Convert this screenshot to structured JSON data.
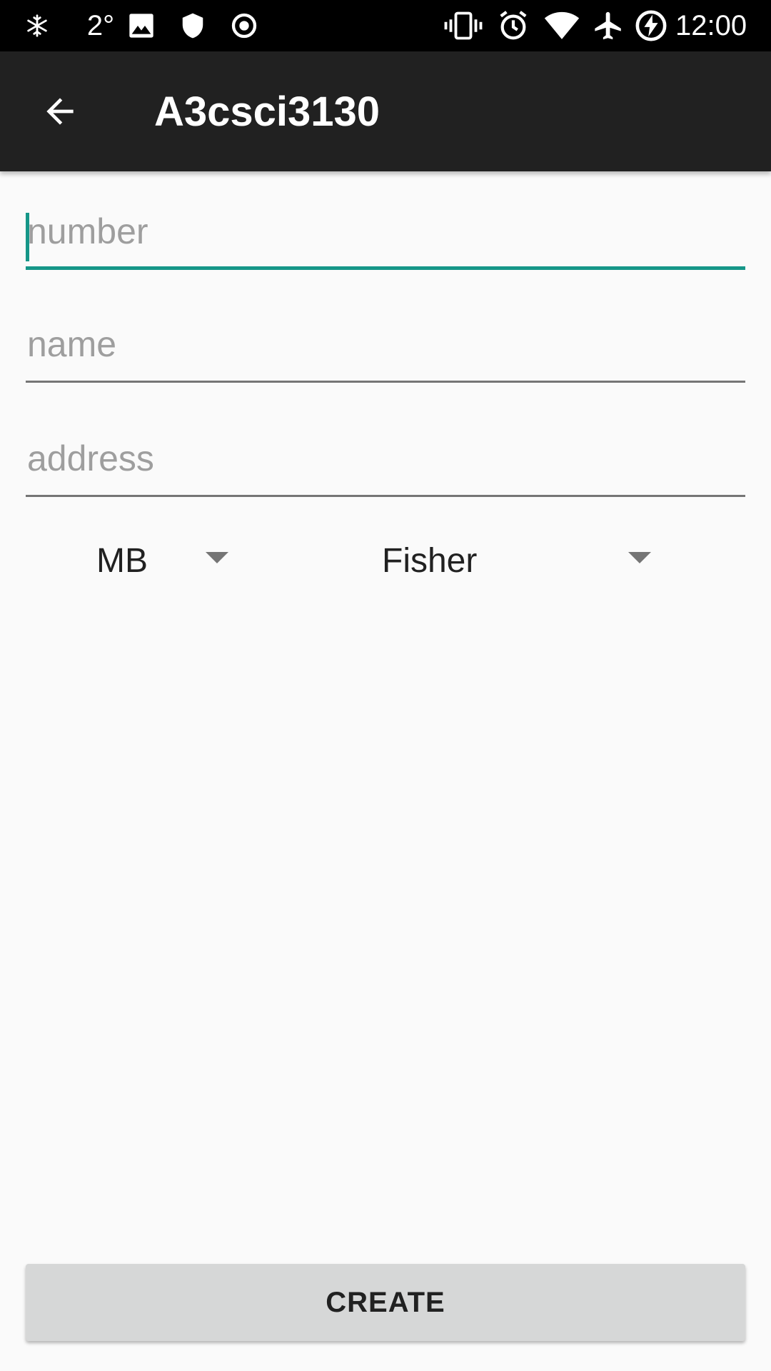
{
  "status_bar": {
    "temperature": "2°",
    "time": "12:00",
    "icons": [
      "snowflake-icon",
      "image-icon",
      "shield-icon",
      "target-icon",
      "vibrate-icon",
      "alarm-icon",
      "wifi-icon",
      "airplane-icon",
      "battery-charging-icon"
    ]
  },
  "app_bar": {
    "title": "A3csci3130",
    "back_icon": "arrow-left-icon"
  },
  "form": {
    "number": {
      "value": "",
      "placeholder": "number"
    },
    "name": {
      "value": "",
      "placeholder": "name"
    },
    "address": {
      "value": "",
      "placeholder": "address"
    },
    "province_spinner": {
      "selected": "MB"
    },
    "business_spinner": {
      "selected": "Fisher"
    }
  },
  "actions": {
    "create_label": "CREATE"
  },
  "colors": {
    "status_bar": "#000000",
    "app_bar": "#212121",
    "accent": "#159688",
    "background": "#fafafa",
    "button": "#d6d7d7"
  }
}
